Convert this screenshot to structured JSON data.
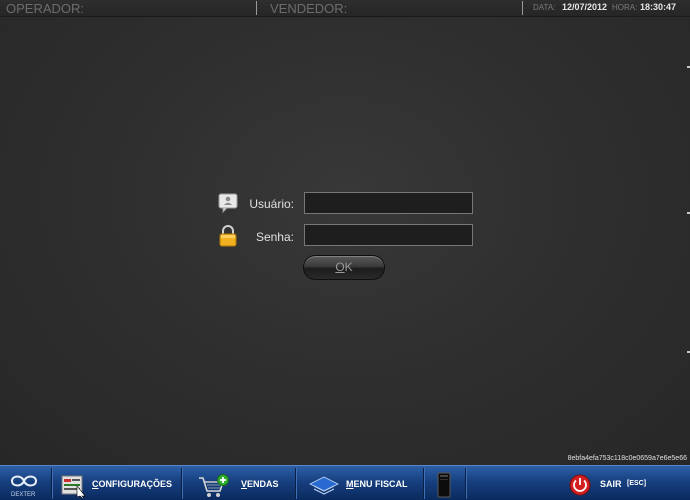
{
  "topbar": {
    "operator_label": "OPERADOR:",
    "seller_label": "VENDEDOR:",
    "date_label": "DATA:",
    "date_value": "12/07/2012",
    "time_label": "HORA:",
    "time_value": "18:30:47"
  },
  "login": {
    "user_label": "Usuário:",
    "user_value": "",
    "password_label": "Senha:",
    "password_value": "",
    "ok_first": "O",
    "ok_rest": "K"
  },
  "hash_code": "8ebfa4efa753c118c0e0659a7e6e5e66",
  "bottombar": {
    "logo_text": "DEXTER",
    "config_first": "C",
    "config_rest": "ONFIGURAÇÕES",
    "sales_first": "V",
    "sales_rest": "ENDAS",
    "fiscal_first": "M",
    "fiscal_rest": "ENU FISCAL",
    "exit_label": "SAIR",
    "exit_key": "[ESC]"
  },
  "colors": {
    "background": "#2c2c2c",
    "bar_blue": "#17407f",
    "exit_red": "#d22020"
  }
}
